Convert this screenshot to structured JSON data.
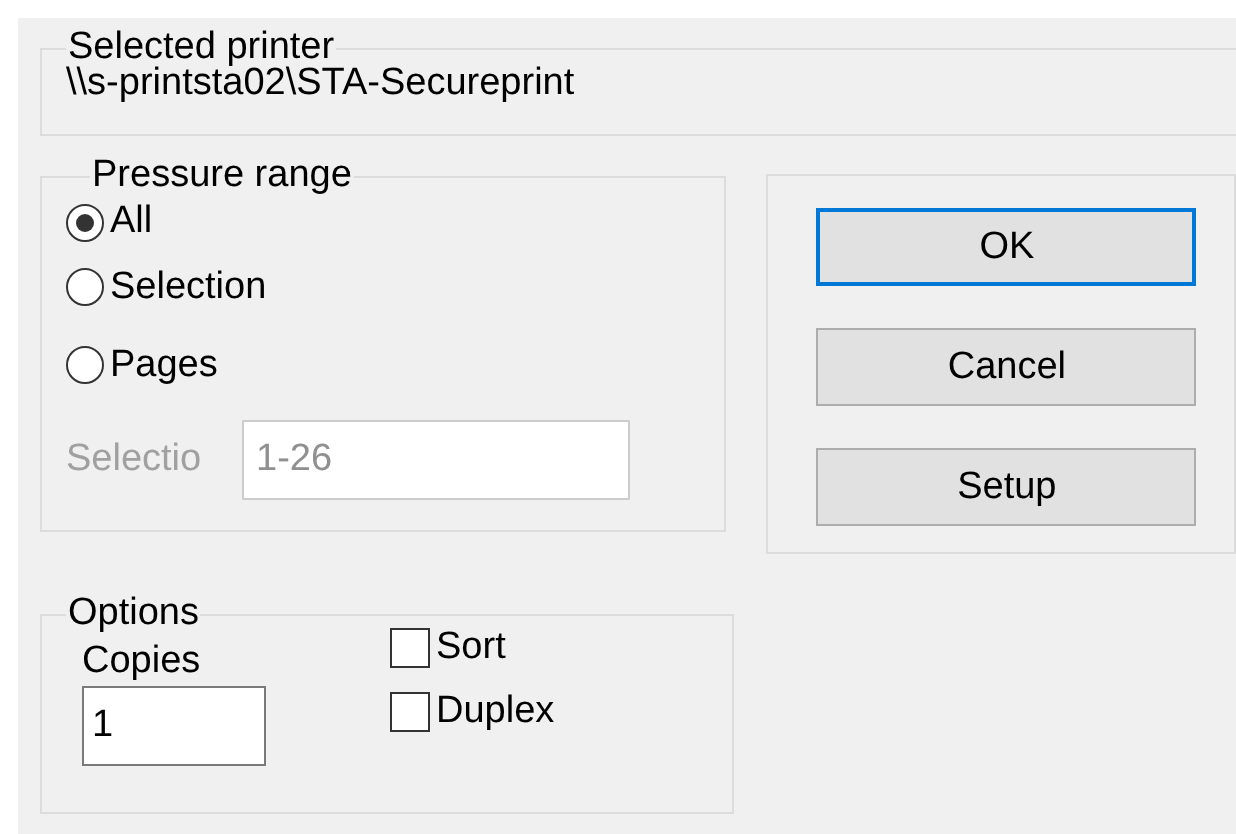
{
  "selected_printer": {
    "label": "Selected printer",
    "value": "\\\\s-printsta02\\STA-Secureprint"
  },
  "pressure_range": {
    "label": "Pressure range",
    "options": [
      {
        "label": "All",
        "selected": true
      },
      {
        "label": "Selection",
        "selected": false
      },
      {
        "label": "Pages",
        "selected": false
      }
    ],
    "page_field": {
      "label": "Selectio",
      "value": "1-26",
      "disabled": true
    }
  },
  "buttons": [
    {
      "label": "OK",
      "focused": true
    },
    {
      "label": "Cancel",
      "focused": false
    },
    {
      "label": "Setup",
      "focused": false
    }
  ],
  "options": {
    "label": "Options",
    "copies": {
      "label": "Copies",
      "value": "1"
    },
    "checkboxes": [
      {
        "label": "Sort",
        "checked": false
      },
      {
        "label": "Duplex",
        "checked": false
      }
    ]
  }
}
